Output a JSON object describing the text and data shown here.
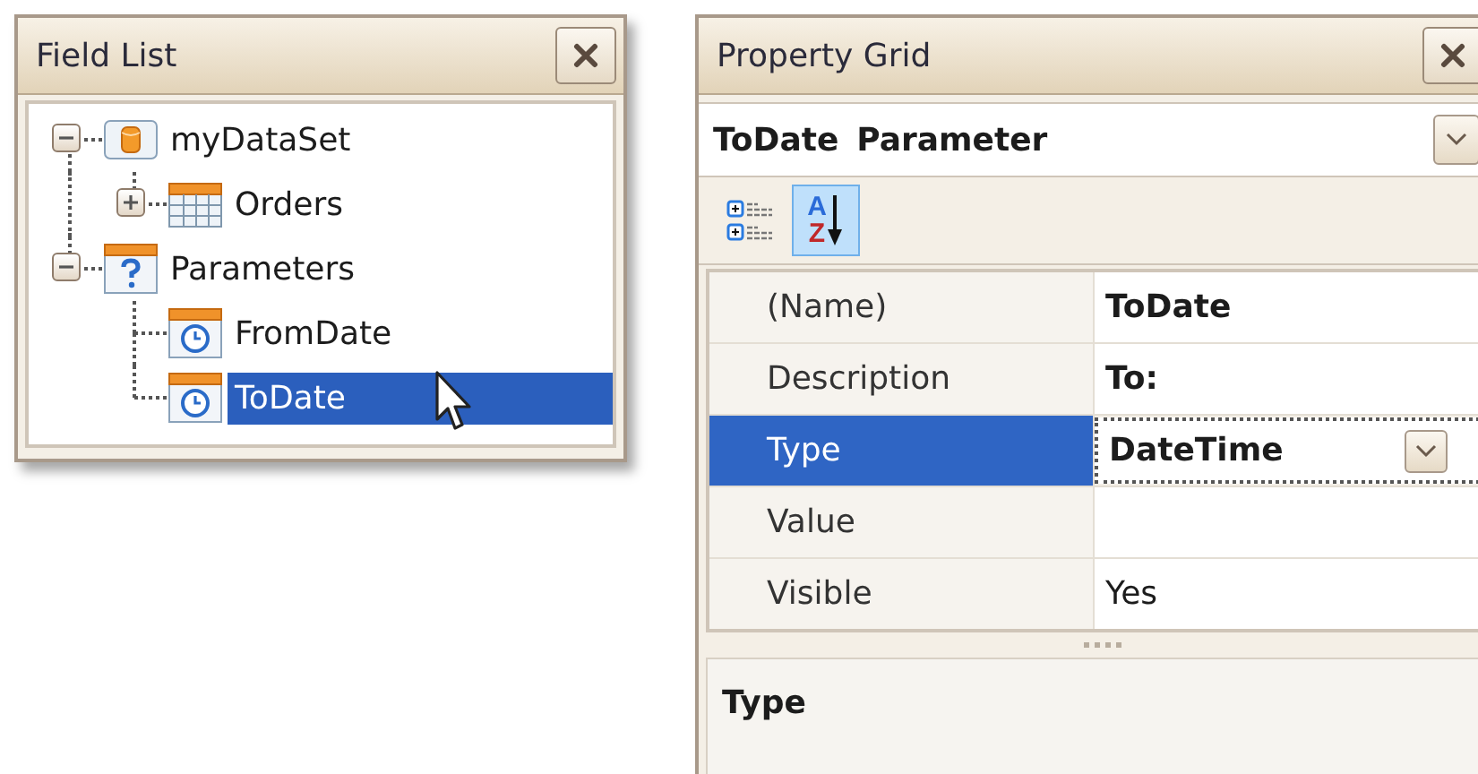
{
  "field_list": {
    "title": "Field List",
    "tree": [
      {
        "label": "myDataSet",
        "kind": "dataset",
        "expanded": true,
        "selected": false,
        "children": [
          {
            "label": "Orders",
            "kind": "table",
            "expanded": false,
            "selected": false
          }
        ]
      },
      {
        "label": "Parameters",
        "kind": "parameters",
        "expanded": true,
        "selected": false,
        "children": [
          {
            "label": "FromDate",
            "kind": "parameter",
            "selected": false
          },
          {
            "label": "ToDate",
            "kind": "parameter",
            "selected": true
          }
        ]
      }
    ]
  },
  "property_grid": {
    "title": "Property Grid",
    "selector": {
      "name": "ToDate",
      "type": "Parameter"
    },
    "toolbar": [
      {
        "kind": "categorized",
        "selected": false
      },
      {
        "kind": "alphabetical",
        "selected": true,
        "letters": [
          "A",
          "Z"
        ]
      }
    ],
    "rows": [
      {
        "name": "(Name)",
        "value": "ToDate",
        "modified": true,
        "selected": false,
        "kind": "text"
      },
      {
        "name": "Description",
        "value": "To:",
        "modified": true,
        "selected": false,
        "kind": "text"
      },
      {
        "name": "Type",
        "value": "DateTime",
        "modified": true,
        "selected": true,
        "kind": "dropdown"
      },
      {
        "name": "Value",
        "selected": false,
        "kind": "text"
      },
      {
        "name": "Visible",
        "value": "Yes",
        "modified": false,
        "selected": false,
        "kind": "text"
      }
    ],
    "description": {
      "title": "Type"
    }
  }
}
